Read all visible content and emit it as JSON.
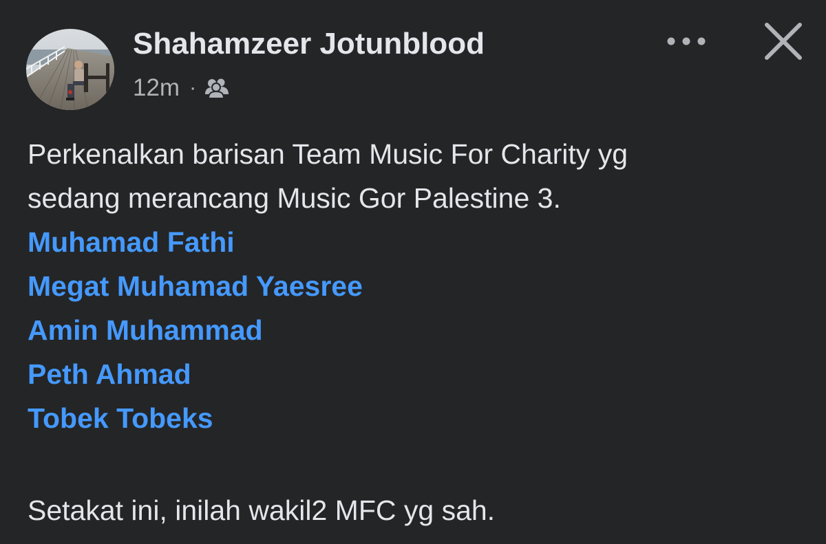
{
  "post": {
    "author": "Shahamzeer Jotunblood",
    "timestamp": "12m",
    "separator": "·",
    "audience_icon": "friends-icon",
    "avatar": "profile-photo-pier",
    "actions": {
      "more_icon": "more-options-icon",
      "close_icon": "close-icon"
    },
    "body_lines": [
      "Perkenalkan barisan Team Music For Charity yg",
      "sedang merancang Music Gor Palestine 3."
    ],
    "mentions": [
      "Muhamad Fathi",
      "Megat Muhamad Yaesree",
      "Amin Muhammad",
      "Peth Ahmad",
      "Tobek Tobeks"
    ],
    "closing": "Setakat ini, inilah wakil2 MFC yg sah."
  },
  "colors": {
    "background": "#242526",
    "text_primary": "#e4e6eb",
    "text_secondary": "#b0b3b8",
    "mention_link": "#4599ff"
  }
}
